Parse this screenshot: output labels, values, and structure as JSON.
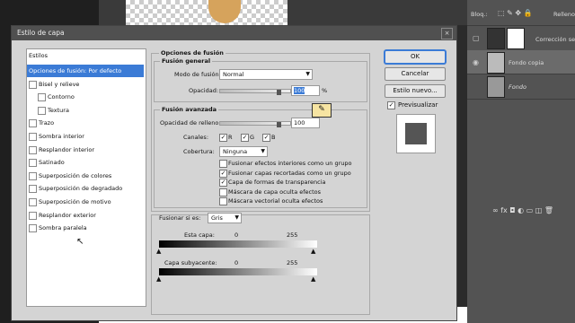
{
  "dialog": {
    "title": "Estilo de capa",
    "close": "×"
  },
  "styles": {
    "header": "Estilos",
    "items": [
      {
        "label": "Opciones de fusión: Por defecto",
        "checkbox": false,
        "indent": false,
        "selected": true
      },
      {
        "label": "Bisel y relieve",
        "checkbox": true,
        "indent": false
      },
      {
        "label": "Contorno",
        "checkbox": true,
        "indent": true
      },
      {
        "label": "Textura",
        "checkbox": true,
        "indent": true
      },
      {
        "label": "Trazo",
        "checkbox": true,
        "indent": false
      },
      {
        "label": "Sombra interior",
        "checkbox": true,
        "indent": false
      },
      {
        "label": "Resplandor interior",
        "checkbox": true,
        "indent": false
      },
      {
        "label": "Satinado",
        "checkbox": true,
        "indent": false
      },
      {
        "label": "Superposición de colores",
        "checkbox": true,
        "indent": false
      },
      {
        "label": "Superposición de degradado",
        "checkbox": true,
        "indent": false
      },
      {
        "label": "Superposición de motivo",
        "checkbox": true,
        "indent": false
      },
      {
        "label": "Resplandor exterior",
        "checkbox": true,
        "indent": false
      },
      {
        "label": "Sombra paralela",
        "checkbox": true,
        "indent": false
      }
    ]
  },
  "blend": {
    "section_title": "Opciones de fusión",
    "general_title": "Fusión general",
    "mode_label": "Modo de fusión:",
    "mode_value": "Normal",
    "opacity_label": "Opacidad:",
    "opacity_value": "100",
    "opacity_unit": "%",
    "advanced_title": "Fusión avanzada",
    "fill_label": "Opacidad de relleno:",
    "fill_value": "100",
    "channels_label": "Canales:",
    "channel_r": "R",
    "channel_g": "G",
    "channel_b": "B",
    "knockout_label": "Cobertura:",
    "knockout_value": "Ninguna",
    "options": [
      {
        "label": "Fusionar efectos interiores como un grupo",
        "checked": false
      },
      {
        "label": "Fusionar capas recortadas como un grupo",
        "checked": true
      },
      {
        "label": "Capa de formas de transparencia",
        "checked": true
      },
      {
        "label": "Máscara de capa oculta efectos",
        "checked": false
      },
      {
        "label": "Máscara vectorial oculta efectos",
        "checked": false
      }
    ],
    "blendif_label": "Fusionar si es:",
    "blendif_value": "Gris",
    "this_layer_label": "Esta capa:",
    "this_layer_min": "0",
    "this_layer_max": "255",
    "underlying_label": "Capa subyacente:",
    "underlying_min": "0",
    "underlying_max": "255"
  },
  "buttons": {
    "ok": "OK",
    "cancel": "Cancelar",
    "new_style": "Estilo nuevo...",
    "preview": "Previsualizar"
  },
  "layers": {
    "header_left": "Bloq.:",
    "header_right": "Relleno",
    "rows": [
      {
        "name": "Corrección sel"
      },
      {
        "name": "Fondo copia"
      },
      {
        "name": "Fondo"
      }
    ],
    "footer_icons": "∞  fx  ◘  ◐  ▭  ◫  🗑"
  }
}
